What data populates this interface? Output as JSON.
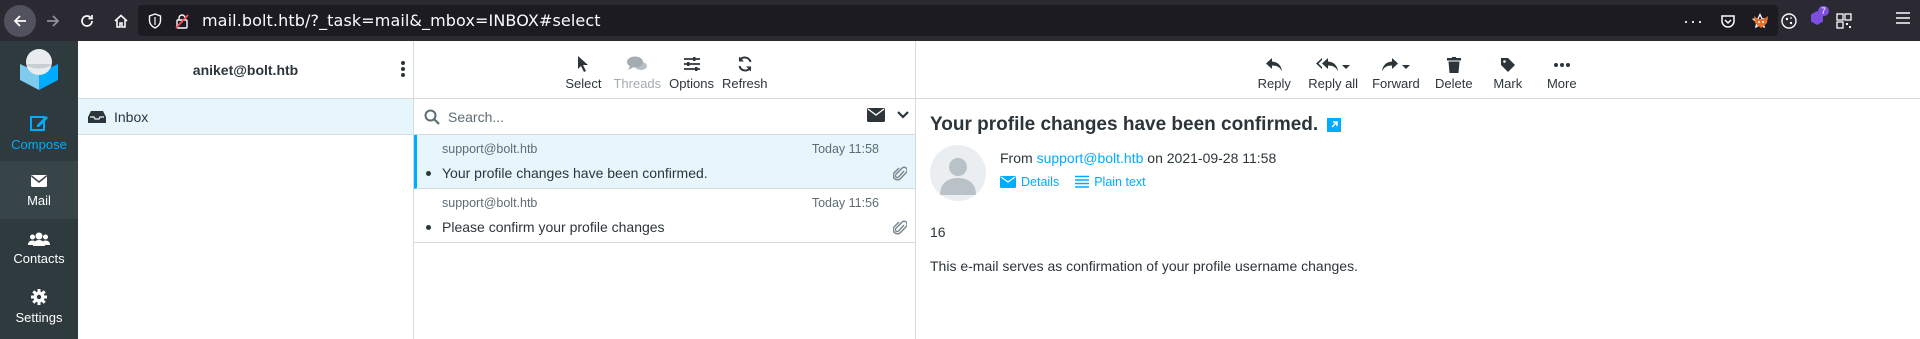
{
  "browser": {
    "url": "mail.bolt.htb/?_task=mail&_mbox=INBOX#select",
    "ext_badge": "7"
  },
  "leftbar": {
    "compose": "Compose",
    "mail": "Mail",
    "contacts": "Contacts",
    "settings": "Settings"
  },
  "folders": {
    "account": "aniket@bolt.htb",
    "items": [
      {
        "label": "Inbox"
      }
    ]
  },
  "list_toolbar": {
    "select": "Select",
    "threads": "Threads",
    "options": "Options",
    "refresh": "Refresh"
  },
  "search": {
    "placeholder": "Search..."
  },
  "messages": [
    {
      "from": "support@bolt.htb",
      "date": "Today 11:58",
      "subject": "Your profile changes have been confirmed."
    },
    {
      "from": "support@bolt.htb",
      "date": "Today 11:56",
      "subject": "Please confirm your profile changes"
    }
  ],
  "preview_toolbar": {
    "reply": "Reply",
    "reply_all": "Reply all",
    "forward": "Forward",
    "delete": "Delete",
    "mark": "Mark",
    "more": "More"
  },
  "preview": {
    "subject": "Your profile changes have been confirmed.",
    "from_prefix": "From",
    "from_addr": "support@bolt.htb",
    "on_date": "on 2021-09-28 11:58",
    "details": "Details",
    "plain_text": "Plain text",
    "body_line1": "16",
    "body_line2": "This e-mail serves as confirmation of your profile username changes."
  },
  "colors": {
    "accent": "#00acff",
    "sidebar": "#2f3a3f",
    "browser": "#2b2a33"
  }
}
